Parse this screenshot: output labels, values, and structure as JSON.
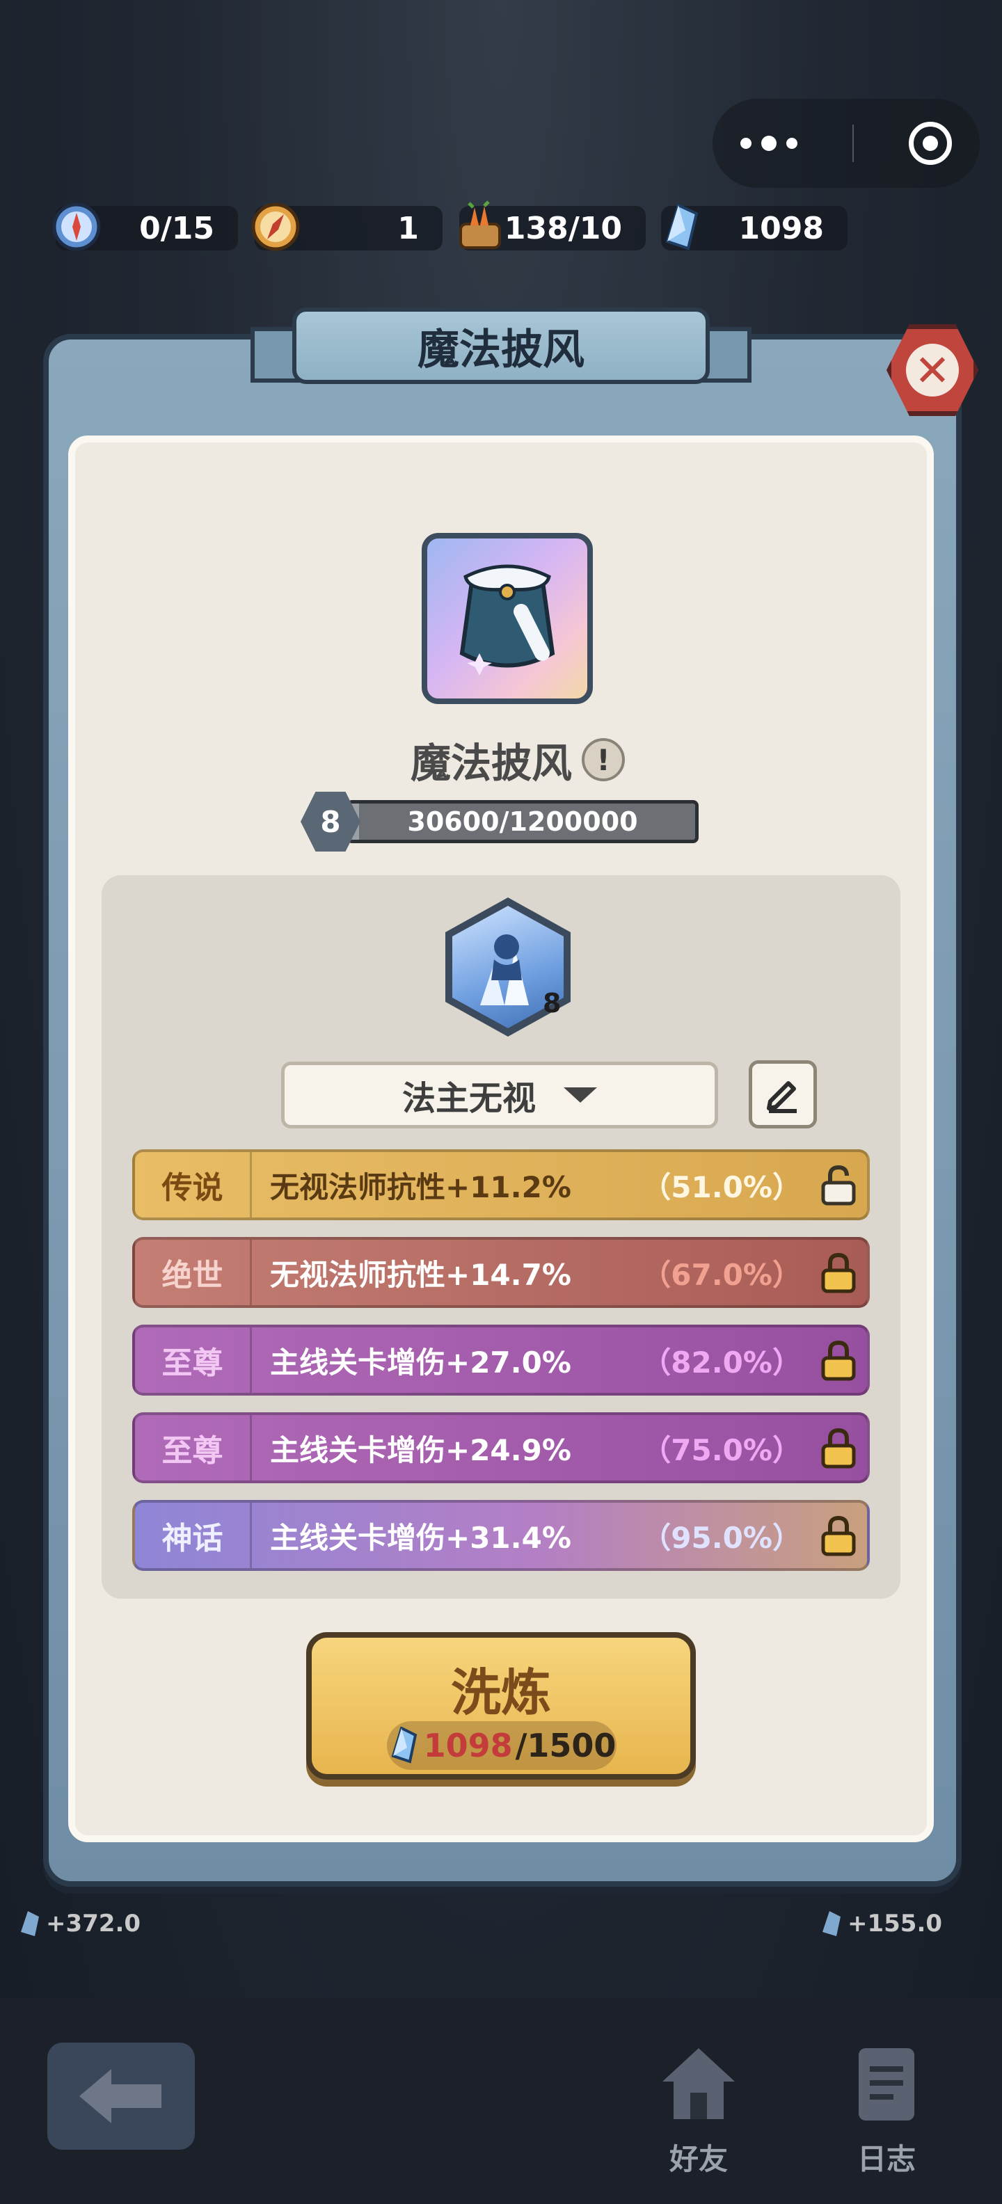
{
  "resources": [
    {
      "icon": "compass-icon",
      "value": "0/15"
    },
    {
      "icon": "golden-compass-icon",
      "value": "1"
    },
    {
      "icon": "carrot-basket-icon",
      "value": "138/10"
    },
    {
      "icon": "crystal-icon",
      "value": "1098"
    }
  ],
  "dialog": {
    "title": "魔法披风",
    "item_name": "魔法披风",
    "level": "8",
    "xp_text": "30600/1200000",
    "xp_progress": 0.0255,
    "skill_level": "8",
    "skill_dropdown": "法主无视",
    "attributes": [
      {
        "tier": "传说",
        "desc": "无视法师抗性+11.2%",
        "pct": "（51.0%）",
        "locked": false
      },
      {
        "tier": "绝世",
        "desc": "无视法师抗性+14.7%",
        "pct": "（67.0%）",
        "locked": true
      },
      {
        "tier": "至尊",
        "desc": "主线关卡增伤+27.0%",
        "pct": "（82.0%）",
        "locked": true
      },
      {
        "tier": "至尊",
        "desc": "主线关卡增伤+24.9%",
        "pct": "（75.0%）",
        "locked": true
      },
      {
        "tier": "神话",
        "desc": "主线关卡增伤+31.4%",
        "pct": "（95.0%）",
        "locked": true
      }
    ],
    "refine_button": "洗炼",
    "refine_cost_current": "1098",
    "refine_cost_required": "/1500"
  },
  "background": {
    "left_value": "+372.0",
    "right_value": "+155.0"
  },
  "bottom_nav": {
    "friends": "好友",
    "log": "日志"
  },
  "colors": {
    "legend": "#e2b35a",
    "peerless": "#b5675e",
    "supreme": "#a05aa8",
    "myth": "#8b7fd0"
  }
}
